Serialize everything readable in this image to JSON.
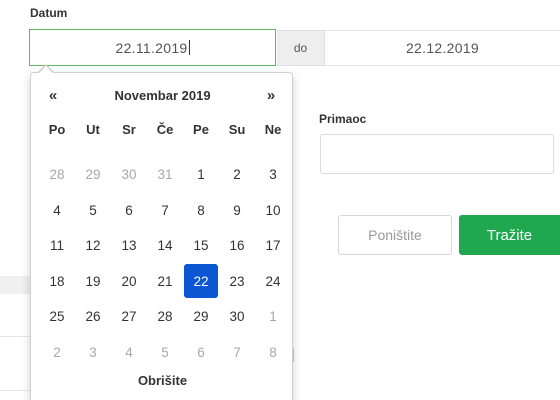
{
  "filters": {
    "datum_label": "Datum",
    "date_from": "22.11.2019",
    "do_label": "do",
    "date_to": "22.12.2019",
    "primaoc_label": "Primaoc",
    "primaoc_value": ""
  },
  "actions": {
    "reset_label": "Poništite",
    "search_label": "Tražite"
  },
  "datepicker": {
    "prev": "«",
    "next": "»",
    "month_title": "Novembar 2019",
    "weekdays": [
      "Po",
      "Ut",
      "Sr",
      "Če",
      "Pe",
      "Su",
      "Ne"
    ],
    "weeks": [
      [
        "28",
        "29",
        "30",
        "31",
        "1",
        "2",
        "3"
      ],
      [
        "4",
        "5",
        "6",
        "7",
        "8",
        "9",
        "10"
      ],
      [
        "11",
        "12",
        "13",
        "14",
        "15",
        "16",
        "17"
      ],
      [
        "18",
        "19",
        "20",
        "21",
        "22",
        "23",
        "24"
      ],
      [
        "25",
        "26",
        "27",
        "28",
        "29",
        "30",
        "1"
      ],
      [
        "2",
        "3",
        "4",
        "5",
        "6",
        "7",
        "8"
      ]
    ],
    "muted": [
      [
        true,
        true,
        true,
        true,
        false,
        false,
        false
      ],
      [
        false,
        false,
        false,
        false,
        false,
        false,
        false
      ],
      [
        false,
        false,
        false,
        false,
        false,
        false,
        false
      ],
      [
        false,
        false,
        false,
        false,
        false,
        false,
        false
      ],
      [
        false,
        false,
        false,
        false,
        false,
        false,
        true
      ],
      [
        true,
        true,
        true,
        true,
        true,
        true,
        true
      ]
    ],
    "selected_day": "22",
    "clear_label": "Obrišite"
  },
  "colors": {
    "accent_green": "#1fa84f",
    "focus_border": "#5cb85c",
    "selected_blue": "#0b56d1"
  }
}
